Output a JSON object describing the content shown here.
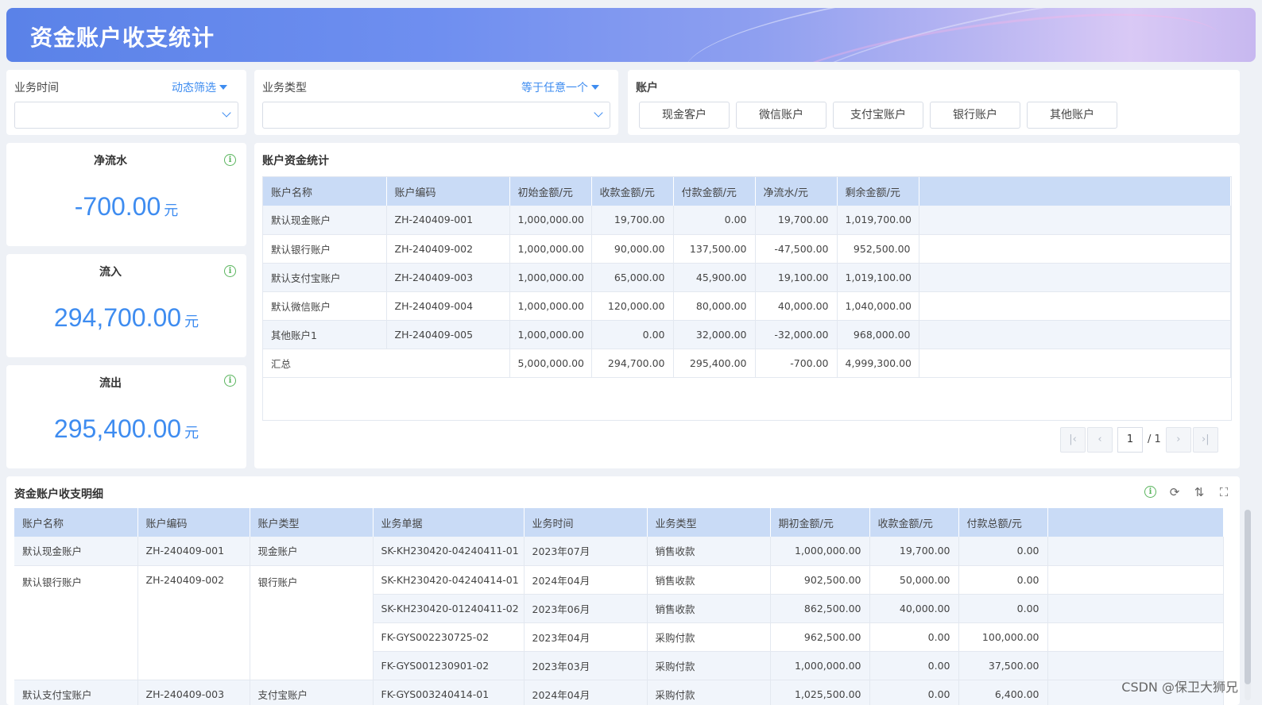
{
  "header": {
    "title": "资金账户收支统计"
  },
  "filters": {
    "time": {
      "label": "业务时间",
      "mode": "动态筛选",
      "value": ""
    },
    "type": {
      "label": "业务类型",
      "mode": "等于任意一个",
      "value": ""
    },
    "account": {
      "label": "账户",
      "buttons": [
        "现金客户",
        "微信账户",
        "支付宝账户",
        "银行账户",
        "其他账户"
      ]
    }
  },
  "kpis": [
    {
      "title": "净流水",
      "value": "-700.00",
      "unit": "元"
    },
    {
      "title": "流入",
      "value": "294,700.00",
      "unit": "元"
    },
    {
      "title": "流出",
      "value": "295,400.00",
      "unit": "元"
    }
  ],
  "summary": {
    "title": "账户资金统计",
    "columns": [
      "账户名称",
      "账户编码",
      "初始金额/元",
      "收款金额/元",
      "付款金额/元",
      "净流水/元",
      "剩余金额/元"
    ],
    "rows": [
      [
        "默认现金账户",
        "ZH-240409-001",
        "1,000,000.00",
        "19,700.00",
        "0.00",
        "19,700.00",
        "1,019,700.00"
      ],
      [
        "默认银行账户",
        "ZH-240409-002",
        "1,000,000.00",
        "90,000.00",
        "137,500.00",
        "-47,500.00",
        "952,500.00"
      ],
      [
        "默认支付宝账户",
        "ZH-240409-003",
        "1,000,000.00",
        "65,000.00",
        "45,900.00",
        "19,100.00",
        "1,019,100.00"
      ],
      [
        "默认微信账户",
        "ZH-240409-004",
        "1,000,000.00",
        "120,000.00",
        "80,000.00",
        "40,000.00",
        "1,040,000.00"
      ],
      [
        "其他账户1",
        "ZH-240409-005",
        "1,000,000.00",
        "0.00",
        "32,000.00",
        "-32,000.00",
        "968,000.00"
      ]
    ],
    "total": [
      "汇总",
      "",
      "5,000,000.00",
      "294,700.00",
      "295,400.00",
      "-700.00",
      "4,999,300.00"
    ],
    "pager": {
      "first": "K",
      "prev": "‹",
      "page": "1",
      "total": "/ 1",
      "next": "›",
      "last": "K"
    }
  },
  "detail": {
    "title": "资金账户收支明细",
    "columns": [
      "账户名称",
      "账户编码",
      "账户类型",
      "业务单据",
      "业务时间",
      "业务类型",
      "期初金额/元",
      "收款金额/元",
      "付款总额/元"
    ],
    "rows": [
      [
        "默认现金账户",
        "ZH-240409-001",
        "现金账户",
        "SK-KH230420-04240411-01",
        "2023年07月",
        "销售收款",
        "1,000,000.00",
        "19,700.00",
        "0.00"
      ],
      [
        "默认银行账户",
        "ZH-240409-002",
        "银行账户",
        "SK-KH230420-04240414-01",
        "2024年04月",
        "销售收款",
        "902,500.00",
        "50,000.00",
        "0.00"
      ],
      [
        "",
        "",
        "",
        "SK-KH230420-01240411-02",
        "2023年06月",
        "销售收款",
        "862,500.00",
        "40,000.00",
        "0.00"
      ],
      [
        "",
        "",
        "",
        "FK-GYS002230725-02",
        "2023年04月",
        "采购付款",
        "962,500.00",
        "0.00",
        "100,000.00"
      ],
      [
        "",
        "",
        "",
        "FK-GYS001230901-02",
        "2023年03月",
        "采购付款",
        "1,000,000.00",
        "0.00",
        "37,500.00"
      ],
      [
        "默认支付宝账户",
        "ZH-240409-003",
        "支付宝账户",
        "FK-GYS003240414-01",
        "2024年04月",
        "采购付款",
        "1,025,500.00",
        "0.00",
        "6,400.00"
      ]
    ]
  },
  "watermark": "CSDN @保卫大狮兄"
}
